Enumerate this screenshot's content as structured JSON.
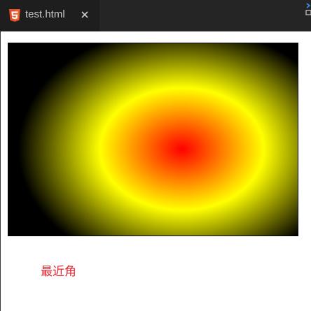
{
  "tab": {
    "icon": "html5-icon",
    "label": "test.html",
    "close_icon": "close-icon"
  },
  "demo": {
    "gradient": {
      "shape": "radial",
      "size": "closest-corner",
      "center": [
        0.6,
        0.55
      ],
      "stops": [
        {
          "color": "#ff0000",
          "at": 0
        },
        {
          "color": "#ffff00",
          "at": 0.5
        },
        {
          "color": "#000000",
          "at": 1
        }
      ]
    },
    "caption": "最近角",
    "caption_color": "#e0262f"
  },
  "colors": {
    "tab_bar": "#252526",
    "active_tab": "#1e1e1e",
    "tab_text": "#c8c8c8",
    "html5_orange": "#e44d26"
  }
}
